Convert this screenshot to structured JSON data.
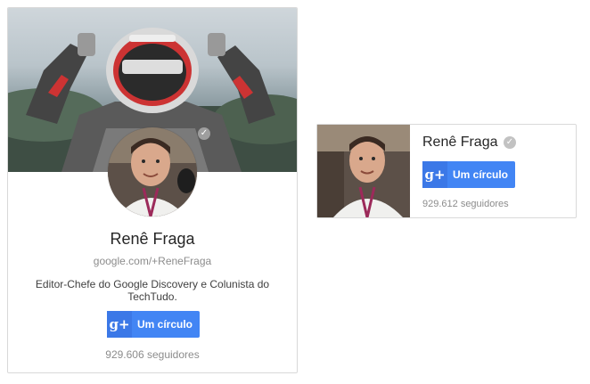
{
  "large_badge": {
    "name": "Renê Fraga",
    "url": "google.com/+ReneFraga",
    "tagline": "Editor-Chefe do Google Discovery e Colunista do TechTudo.",
    "follow_label": "Um círculo",
    "followers": "929.606 seguidores",
    "verified_glyph": "✓",
    "gplus_glyph": "g+"
  },
  "small_badge": {
    "name": "Renê Fraga",
    "follow_label": "Um círculo",
    "followers": "929.612 seguidores",
    "verified_glyph": "✓",
    "gplus_glyph": "g+"
  },
  "colors": {
    "button": "#4285f4",
    "button_icon": "#3b78e7",
    "border": "#d9d9d9",
    "muted_text": "#8c8c8c"
  },
  "icons": [
    "verified-check-icon",
    "google-plus-icon"
  ]
}
